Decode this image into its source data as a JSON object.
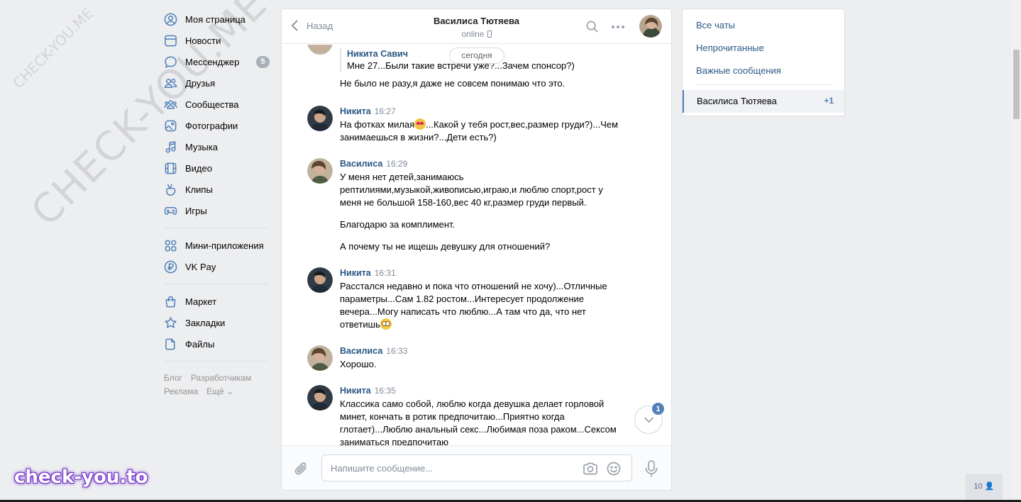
{
  "nav": {
    "items": [
      {
        "label": "Моя страница",
        "icon": "user-icon"
      },
      {
        "label": "Новости",
        "icon": "news-icon"
      },
      {
        "label": "Мессенджер",
        "icon": "messenger-icon",
        "badge": "5"
      },
      {
        "label": "Друзья",
        "icon": "friends-icon"
      },
      {
        "label": "Сообщества",
        "icon": "groups-icon"
      },
      {
        "label": "Фотографии",
        "icon": "photos-icon"
      },
      {
        "label": "Музыка",
        "icon": "music-icon"
      },
      {
        "label": "Видео",
        "icon": "video-icon"
      },
      {
        "label": "Клипы",
        "icon": "clips-icon"
      },
      {
        "label": "Игры",
        "icon": "games-icon"
      },
      {
        "label": "Мини-приложения",
        "icon": "mini-apps-icon"
      },
      {
        "label": "VK Pay",
        "icon": "vk-pay-icon"
      },
      {
        "label": "Маркет",
        "icon": "market-icon"
      },
      {
        "label": "Закладки",
        "icon": "bookmarks-icon"
      },
      {
        "label": "Файлы",
        "icon": "files-icon"
      }
    ],
    "footer": {
      "blog": "Блог",
      "developers": "Разработчикам",
      "ads": "Реклама",
      "more": "Ещё ⌄"
    }
  },
  "chat": {
    "back_label": "Назад",
    "peer_name": "Василиса Тютяева",
    "peer_status": "online",
    "date_chip": "сегодня",
    "messages": [
      {
        "quote_author": "Никита Савич",
        "quote_text": "Мне 27...Были такие встречи уже?...Зачем спонсор?)",
        "texts": [
          "Не было не разу,я даже не совсем понимаю что это."
        ]
      },
      {
        "author": "Никита",
        "time": "16:27",
        "text_a": "На фотках милая",
        "text_b": "...Какой у тебя рост,вес,размер груди?)...Чем занимаешься в жизни?...Дети есть?)"
      },
      {
        "author": "Василиса",
        "time": "16:29",
        "texts": [
          "У меня нет детей,занимаюсь рептилиями,музыкой,живописью,играю,и люблю спорт,рост у меня не большой 158-160,вес 40 кг,размер груди первый.",
          "Благодарю за комплимент.",
          "А почему ты не ищешь девушку для отношений?"
        ]
      },
      {
        "author": "Никита",
        "time": "16:31",
        "text_a": "Расстался недавно и пока что отношений не хочу)...Отличные параметры...Сам 1.82 ростом...Интересует продолжение вечера...Могу написать что люблю...А там что да, что нет ответишь"
      },
      {
        "author": "Василиса",
        "time": "16:33",
        "texts": [
          "Хорошо."
        ]
      },
      {
        "author": "Никита",
        "time": "16:35",
        "texts": [
          "Классика само собой, люблю когда девушка делает горловой минет, кончать в ротик предпочитаю...Приятно когда глотает)...Люблю анальный секс...Любимая поза раком...Сексом заниматься предпочитаю"
        ]
      }
    ],
    "unread_count": "1",
    "composer_placeholder": "Напишите сообщение..."
  },
  "right_panel": {
    "all_chats": "Все чаты",
    "unread": "Непрочитанные",
    "important": "Важные сообщения",
    "active_chat": "Василиса Тютяева",
    "active_count": "+1"
  },
  "online_friends": "10",
  "watermark": {
    "big": "CHECK-YOU.ME",
    "small": "CHECK-YOU.ME",
    "brand": "check-you.to"
  },
  "colors": {
    "accent": "#5181b8",
    "link": "#2a5885",
    "background": "#edeef0"
  }
}
